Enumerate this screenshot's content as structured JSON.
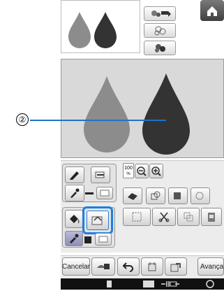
{
  "callout": {
    "number": "②"
  },
  "zoom": {
    "level": "100",
    "unit": "%"
  },
  "bottom_bar": {
    "cancel_label": "Cancelar",
    "next_label": "Avançar"
  },
  "colors": {
    "accent": "#1f7fdc",
    "light_drop": "#8c8c8c",
    "dark_drop": "#333333",
    "canvas_bg": "#d9d9d9"
  },
  "icons": [
    "flower-arrow-icon",
    "flower-icon",
    "flower-dark-icon",
    "home-icon",
    "pencil-icon",
    "line-property-icon",
    "eyedropper-icon",
    "zoom-out-icon",
    "zoom-in-icon",
    "eraser-icon",
    "stamp-icon",
    "select-icon",
    "cut-icon",
    "paint-bucket-icon",
    "fill-property-icon",
    "undo-icon",
    "redo-icon",
    "memory-icon",
    "thread-icon",
    "clock-icon"
  ]
}
